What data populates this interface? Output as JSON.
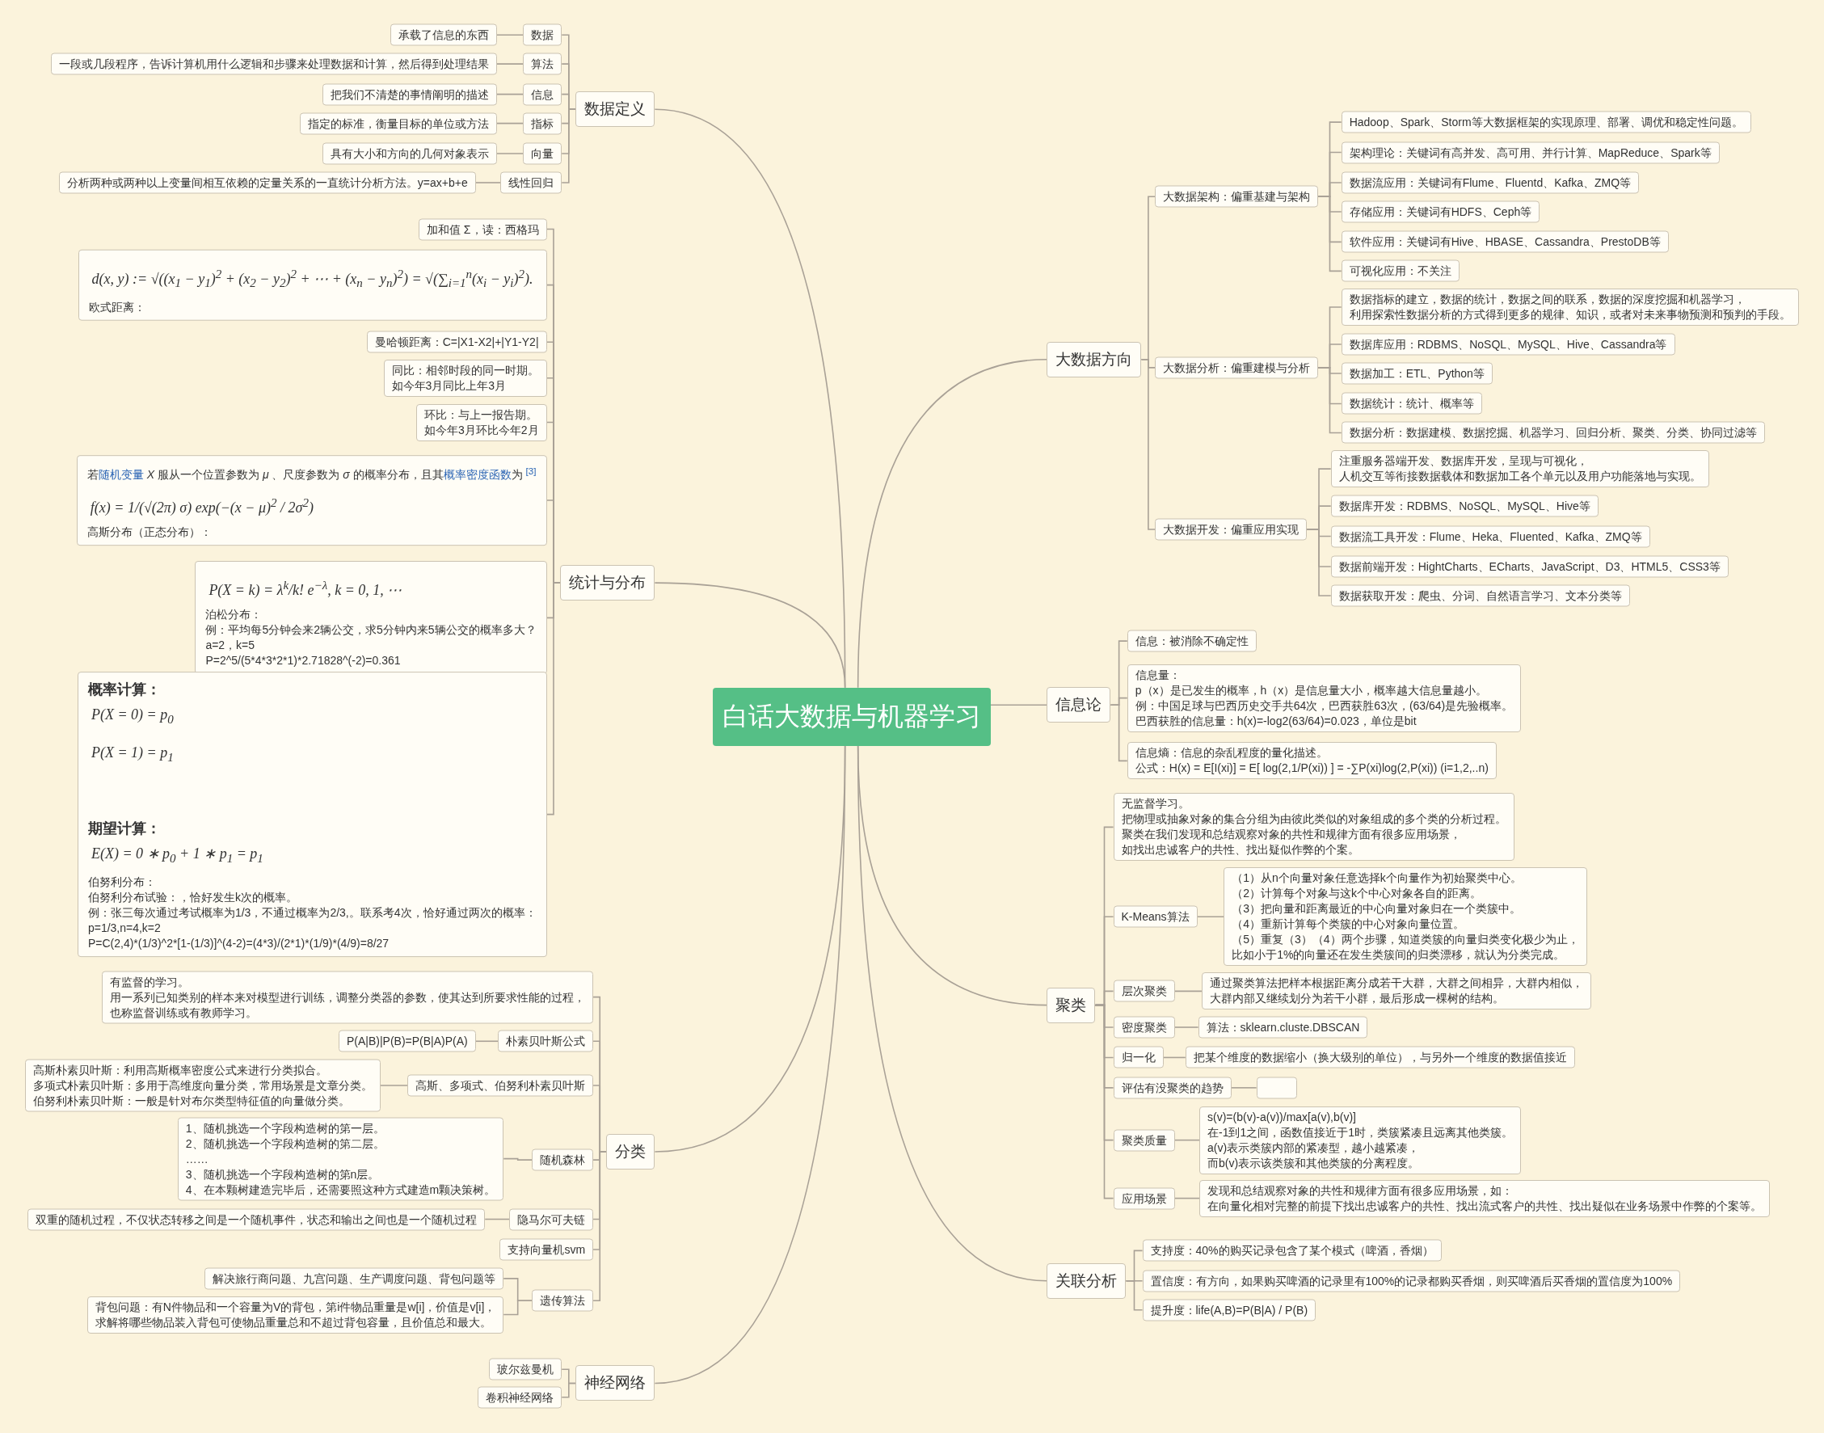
{
  "root": {
    "text": "白话大数据与机器学习"
  },
  "right_branches": [
    {
      "text": "大数据方向",
      "children": [
        {
          "text": "大数据架构：偏重基建与架构",
          "children": [
            {
              "text": "Hadoop、Spark、Storm等大数据框架的实现原理、部署、调优和稳定性问题。"
            },
            {
              "text": "架构理论：关键词有高并发、高可用、并行计算、MapReduce、Spark等"
            },
            {
              "text": "数据流应用：关键词有Flume、Fluentd、Kafka、ZMQ等"
            },
            {
              "text": "存储应用：关键词有HDFS、Ceph等"
            },
            {
              "text": "软件应用：关键词有Hive、HBASE、Cassandra、PrestoDB等"
            },
            {
              "text": "可视化应用：不关注"
            }
          ]
        },
        {
          "text": "大数据分析：偏重建模与分析",
          "children": [
            {
              "lines": [
                "数据指标的建立，数据的统计，数据之间的联系，数据的深度挖掘和机器学习，",
                "利用探索性数据分析的方式得到更多的规律、知识，或者对未来事物预测和预判的手段。"
              ]
            },
            {
              "text": "数据库应用：RDBMS、NoSQL、MySQL、Hive、Cassandra等"
            },
            {
              "text": "数据加工：ETL、Python等"
            },
            {
              "text": "数据统计：统计、概率等"
            },
            {
              "text": "数据分析：数据建模、数据挖掘、机器学习、回归分析、聚类、分类、协同过滤等"
            }
          ]
        },
        {
          "text": "大数据开发：偏重应用实现",
          "children": [
            {
              "lines": [
                "注重服务器端开发、数据库开发，呈现与可视化，",
                "人机交互等衔接数据载体和数据加工各个单元以及用户功能落地与实现。"
              ]
            },
            {
              "text": "数据库开发：RDBMS、NoSQL、MySQL、Hive等"
            },
            {
              "text": "数据流工具开发：Flume、Heka、Fluented、Kafka、ZMQ等"
            },
            {
              "text": "数据前端开发：HightCharts、ECharts、JavaScript、D3、HTML5、CSS3等"
            },
            {
              "text": "数据获取开发：爬虫、分词、自然语言学习、文本分类等"
            }
          ]
        }
      ]
    },
    {
      "text": "信息论",
      "children": [
        {
          "text": "信息：被消除不确定性"
        },
        {
          "lines": [
            "信息量：",
            "p（x）是已发生的概率，h（x）是信息量大小，概率越大信息量越小。",
            "例：中国足球与巴西历史交手共64次，巴西获胜63次，(63/64)是先验概率。",
            "巴西获胜的信息量：h(x)=-log2(63/64)=0.023，单位是bit"
          ]
        },
        {
          "lines": [
            "信息熵：信息的杂乱程度的量化描述。",
            "公式：H(x) = E[I(xi)] = E[ log(2,1/P(xi)) ] = -∑P(xi)log(2,P(xi)) (i=1,2,..n)"
          ]
        }
      ]
    },
    {
      "text": "聚类",
      "children": [
        {
          "lines": [
            "无监督学习。",
            "把物理或抽象对象的集合分组为由彼此类似的对象组成的多个类的分析过程。",
            "聚类在我们发现和总结观察对象的共性和规律方面有很多应用场景，",
            "如找出忠诚客户的共性、找出疑似作弊的个案。"
          ]
        },
        {
          "text": "K-Means算法",
          "children": [
            {
              "lines": [
                "（1）从n个向量对象任意选择k个向量作为初始聚类中心。",
                "（2）计算每个对象与这k个中心对象各自的距离。",
                "（3）把向量和距离最近的中心向量对象归在一个类簇中。",
                "（4）重新计算每个类簇的中心对象向量位置。",
                "（5）重复（3）（4）两个步骤，知道类簇的向量归类变化极少为止，",
                "比如小于1%的向量还在发生类簇间的归类漂移，就认为分类完成。"
              ]
            }
          ]
        },
        {
          "text": "层次聚类",
          "children": [
            {
              "lines": [
                "通过聚类算法把样本根据距离分成若干大群，大群之间相异，大群内相似，",
                "大群内部又继续划分为若干小群，最后形成一棵树的结构。"
              ]
            }
          ]
        },
        {
          "text": "密度聚类",
          "children": [
            {
              "text": "算法：sklearn.cluste.DBSCAN"
            }
          ]
        },
        {
          "text": "归一化",
          "children": [
            {
              "text": "把某个维度的数据缩小（换大级别的单位），与另外一个维度的数据值接近"
            }
          ]
        },
        {
          "text": "评估有没聚类的趋势",
          "children": [
            {
              "kind": "empty"
            }
          ]
        },
        {
          "text": "聚类质量",
          "children": [
            {
              "lines": [
                "s(v)=(b(v)-a(v))/max[a(v),b(v)]",
                "在-1到1之间，函数值接近于1时，类簇紧凑且远离其他类簇。",
                "a(v)表示类簇内部的紧凑型，越小越紧凑，",
                "而b(v)表示该类簇和其他类簇的分离程度。"
              ]
            }
          ]
        },
        {
          "text": "应用场景",
          "children": [
            {
              "lines": [
                "发现和总结观察对象的共性和规律方面有很多应用场景，如：",
                "在向量化相对完整的前提下找出忠诚客户的共性、找出流式客户的共性、找出疑似在业务场景中作弊的个案等。"
              ]
            }
          ]
        }
      ]
    },
    {
      "text": "关联分析",
      "children": [
        {
          "text": "支持度：40%的购买记录包含了某个模式（啤酒，香烟）"
        },
        {
          "text": "置信度：有方向，如果购买啤酒的记录里有100%的记录都购买香烟，则买啤酒后买香烟的置信度为100%"
        },
        {
          "text": "提升度：life(A,B)=P(B|A) / P(B)"
        }
      ]
    }
  ],
  "left_branches": [
    {
      "text": "数据定义",
      "children": [
        {
          "text": "数据",
          "children": [
            {
              "text": "承载了信息的东西"
            }
          ]
        },
        {
          "text": "算法",
          "children": [
            {
              "text": "一段或几段程序，告诉计算机用什么逻辑和步骤来处理数据和计算，然后得到处理结果"
            }
          ]
        },
        {
          "text": "信息",
          "children": [
            {
              "text": "把我们不清楚的事情阐明的描述"
            }
          ]
        },
        {
          "text": "指标",
          "children": [
            {
              "text": "指定的标准，衡量目标的单位或方法"
            }
          ]
        },
        {
          "text": "向量",
          "children": [
            {
              "text": "具有大小和方向的几何对象表示"
            }
          ]
        },
        {
          "text": "线性回归",
          "children": [
            {
              "text": "分析两种或两种以上变量间相互依赖的定量关系的一直统计分析方法。y=ax+b+e"
            }
          ]
        }
      ]
    },
    {
      "text": "统计与分布",
      "children": [
        {
          "text": "加和值 Σ，读：西格玛"
        },
        {
          "blocks": [
            {
              "kind": "formula",
              "text": "d(x, y) := √((x$_{1}$ − y$_{1}$)$^{2}$ + (x$_{2}$ − y$_{2}$)$^{2}$ + ⋯ + (x$_{n}$ − y$_{n}$)$^{2}$) = √(∑$_{i=1}$$^{n}$(x$_{i}$ − y$_{i}$)$^{2}$)."
            },
            {
              "kind": "text",
              "lines": [
                "欧式距离："
              ]
            }
          ]
        },
        {
          "text": "曼哈顿距离：C=|X1-X2|+|Y1-Y2|"
        },
        {
          "lines": [
            "同比：相邻时段的同一时期。",
            "如今年3月同比上年3月"
          ]
        },
        {
          "lines": [
            "环比：与上一报告期。",
            "如今年3月环比今年2月"
          ]
        },
        {
          "blocks": [
            {
              "kind": "segments",
              "parts": [
                {
                  "kind": "plain",
                  "text": "若"
                },
                {
                  "kind": "link",
                  "text": "随机变量"
                },
                {
                  "kind": "plain",
                  "text": " *X* 服从一个位置参数为 *μ* 、尺度参数为 *σ* 的概率分布，且其"
                },
                {
                  "kind": "link",
                  "text": "概率密度函数"
                },
                {
                  "kind": "plain",
                  "text": "为 "
                },
                {
                  "kind": "link",
                  "text": "$^{[3]}$"
                }
              ]
            },
            {
              "kind": "formula",
              "text": "f(x) = 1/(√(2π) σ) exp(−(x − μ)$^{2}$ / 2σ$^{2}$)"
            },
            {
              "kind": "text",
              "lines": [
                "高斯分布（正态分布）："
              ]
            }
          ]
        },
        {
          "blocks": [
            {
              "kind": "formula",
              "text": "P(X = k) = λ$^{k}$/k! e$^{−λ}$, k = 0, 1, ⋯"
            },
            {
              "kind": "text",
              "lines": [
                "泊松分布：",
                "例：平均每5分钟会来2辆公交，求5分钟内来5辆公交的概率多大？",
                "a=2，k=5",
                "P=2^5/(5*4*3*2*1)*2.71828^(-2)=0.361"
              ]
            }
          ]
        },
        {
          "blocks": [
            {
              "kind": "heading",
              "text": "概率计算："
            },
            {
              "kind": "formula",
              "text": "P(X = 0) = p$_{0}$"
            },
            {
              "kind": "formula",
              "text": "P(X = 1) = p$_{1}$"
            },
            {
              "kind": "heading",
              "text": "期望计算："
            },
            {
              "kind": "formula",
              "text": "E(X) = 0 ∗ p$_{0}$ + 1 ∗ p$_{1}$ = p$_{1}$"
            },
            {
              "kind": "text",
              "lines": [
                "伯努利分布：",
                "伯努利分布试验：，恰好发生k次的概率。",
                "例：张三每次通过考试概率为1/3，不通过概率为2/3,。联系考4次，恰好通过两次的概率：",
                "p=1/3,n=4,k=2",
                "P=C(2,4)*(1/3)^2*[1-(1/3)]^(4-2)=(4*3)/(2*1)*(1/9)*(4/9)=8/27"
              ]
            }
          ]
        }
      ]
    },
    {
      "text": "分类",
      "children": [
        {
          "lines": [
            "有监督的学习。",
            "用一系列已知类别的样本来对模型进行训练，调整分类器的参数，使其达到所要求性能的过程，",
            "也称监督训练或有教师学习。"
          ]
        },
        {
          "text": "朴素贝叶斯公式",
          "children": [
            {
              "text": "P(A|B)|P(B)=P(B|A)P(A)"
            }
          ]
        },
        {
          "text": "高斯、多项式、伯努利朴素贝叶斯",
          "children": [
            {
              "lines": [
                "高斯朴素贝叶斯：利用高斯概率密度公式来进行分类拟合。",
                "多项式朴素贝叶斯：多用于高维度向量分类，常用场景是文章分类。",
                "伯努利朴素贝叶斯：一般是针对布尔类型特征值的向量做分类。"
              ]
            }
          ]
        },
        {
          "text": "随机森林",
          "children": [
            {
              "lines": [
                "1、随机挑选一个字段构造树的第一层。",
                "2、随机挑选一个字段构造树的第二层。",
                "……",
                "3、随机挑选一个字段构造树的第n层。",
                "4、在本颗树建造完毕后，还需要照这种方式建造m颗决策树。"
              ]
            }
          ]
        },
        {
          "text": "隐马尔可夫链",
          "children": [
            {
              "text": "双重的随机过程，不仅状态转移之间是一个随机事件，状态和输出之间也是一个随机过程"
            }
          ]
        },
        {
          "text": "支持向量机svm"
        },
        {
          "text": "遗传算法",
          "children": [
            {
              "text": "解决旅行商问题、九宫问题、生产调度问题、背包问题等"
            },
            {
              "lines": [
                "背包问题：有N件物品和一个容量为V的背包，第i件物品重量是w[i]，价值是v[i]，",
                "求解将哪些物品装入背包可使物品重量总和不超过背包容量，且价值总和最大。"
              ]
            }
          ]
        }
      ]
    },
    {
      "text": "神经网络",
      "children": [
        {
          "text": "玻尔兹曼机"
        },
        {
          "text": "卷积神经网络"
        }
      ]
    }
  ]
}
